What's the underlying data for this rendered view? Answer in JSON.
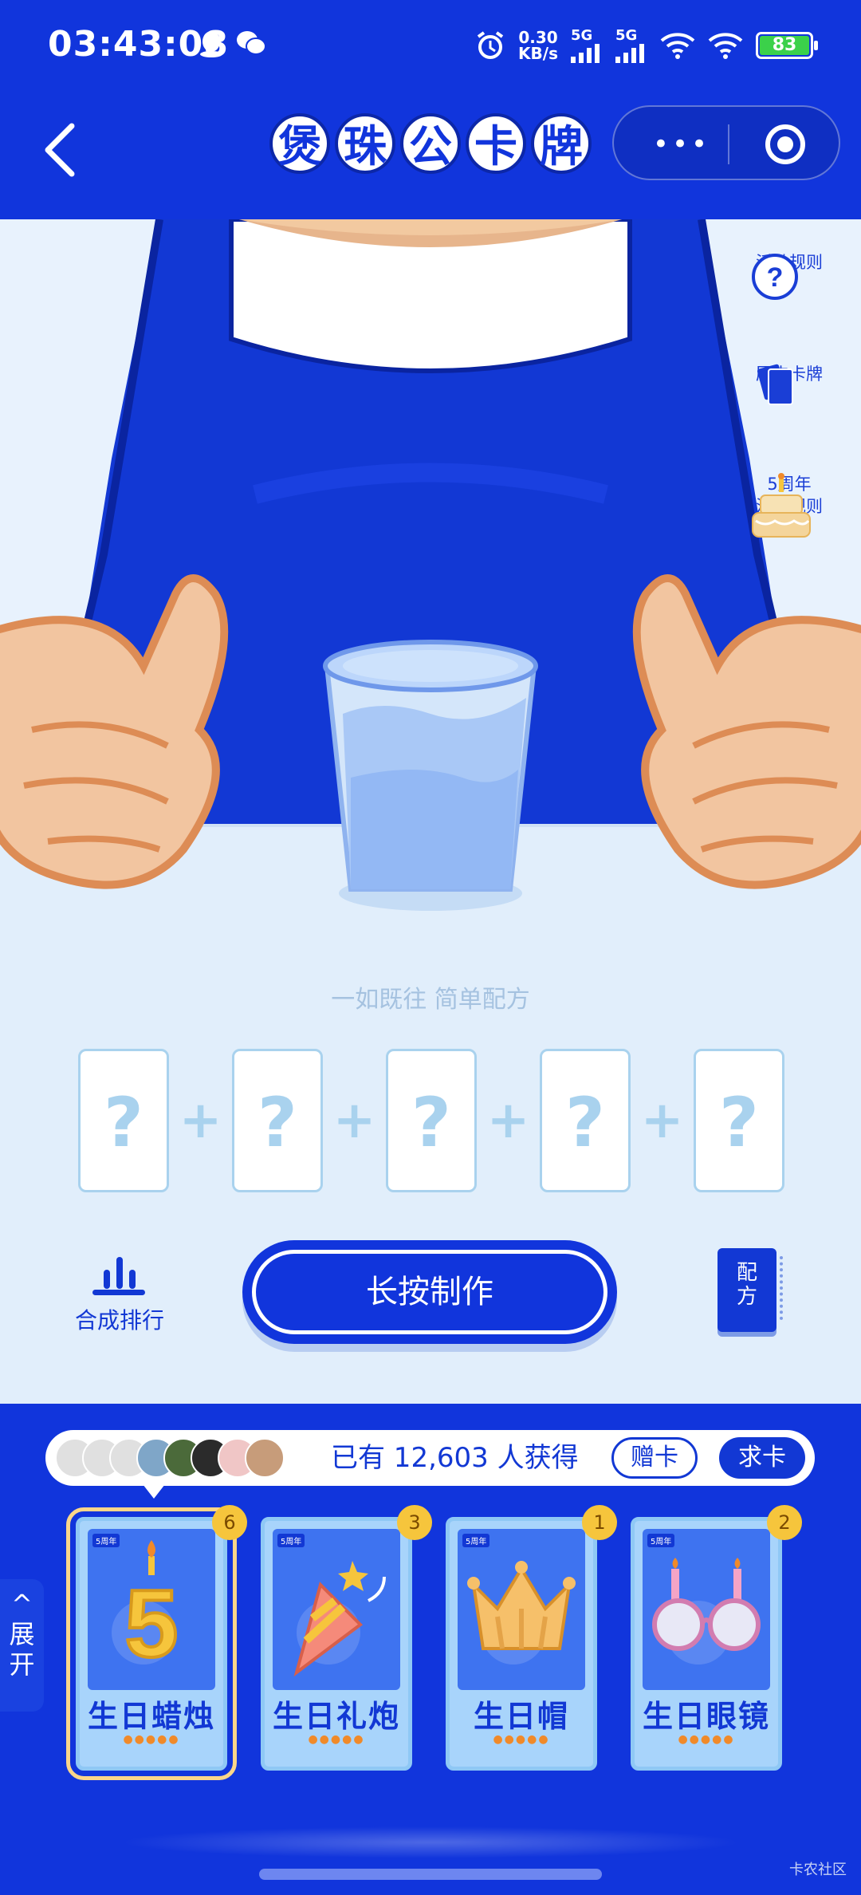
{
  "status_bar": {
    "time": "03:43:08",
    "net_speed": "0.30",
    "net_unit": "KB/s",
    "sig1": "5G",
    "sig2": "5G",
    "battery": "83",
    "icons": [
      "qq-icon",
      "wechat-icon",
      "alarm-icon",
      "signal-icon",
      "wifi-icon",
      "battery-icon"
    ]
  },
  "nav": {
    "title_chars": [
      "煲",
      "珠",
      "公",
      "卡",
      "牌"
    ],
    "more_label": "•••"
  },
  "side_menu": {
    "rules": "活动规则",
    "history": "历史卡牌",
    "anniv_line1": "5周年",
    "anniv_line2": "活动规则"
  },
  "recipe_area": {
    "tagline": "一如既往 简单配方",
    "slots": [
      "?",
      "?",
      "?",
      "?",
      "?"
    ],
    "plus": "+"
  },
  "actions": {
    "ranking": "合成排行",
    "make": "长按制作",
    "recipe_book_1": "配",
    "recipe_book_2": "方"
  },
  "owners": {
    "count_text": "已有 12,603 人获得",
    "gift_button": "赠卡",
    "ask_button": "求卡"
  },
  "cards": [
    {
      "name": "生日蜡烛",
      "count": "6",
      "tag": "5周年",
      "flames": "●●●●●"
    },
    {
      "name": "生日礼炮",
      "count": "3",
      "tag": "5周年",
      "flames": "●●●●●"
    },
    {
      "name": "生日帽",
      "count": "1",
      "tag": "5周年",
      "flames": "●●●●●"
    },
    {
      "name": "生日眼镜",
      "count": "2",
      "tag": "5周年",
      "flames": "●●●●●"
    }
  ],
  "expand": {
    "line1": "展",
    "line2": "开",
    "arrow": "^"
  },
  "watermark": "卡农社区",
  "colors": {
    "brand": "#1135dc",
    "scene_bg": "#e1eefb",
    "badge": "#f6c53c"
  }
}
